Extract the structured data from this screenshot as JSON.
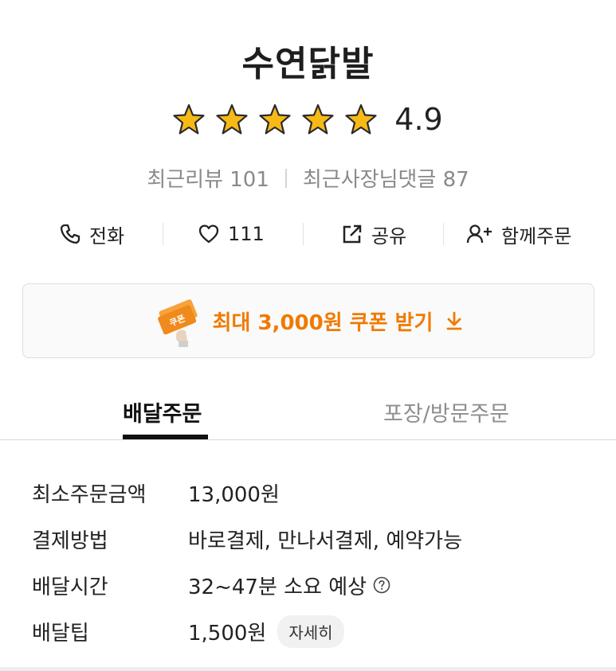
{
  "store": {
    "name": "수연닭발",
    "rating": "4.9",
    "stars": 5,
    "recent_reviews": "최근리뷰 101",
    "recent_owner_replies": "최근사장님댓글 87"
  },
  "actions": {
    "call_label": "전화",
    "like_count": "111",
    "share_label": "공유",
    "group_order_label": "함께주문"
  },
  "coupon": {
    "text": "최대 3,000원 쿠폰 받기",
    "icon_text": "쿠폰",
    "accent_color": "#f07a00"
  },
  "tabs": [
    {
      "label": "배달주문",
      "active": true
    },
    {
      "label": "포장/방문주문",
      "active": false
    }
  ],
  "info": {
    "min_order_label": "최소주문금액",
    "min_order_value": "13,000원",
    "payment_label": "결제방법",
    "payment_value": "바로결제, 만나서결제, 예약가능",
    "delivery_time_label": "배달시간",
    "delivery_time_value": "32~47분 소요 예상",
    "delivery_tip_label": "배달팁",
    "delivery_tip_value": "1,500원",
    "detail_button": "자세히"
  },
  "icons": {
    "star": "star-icon",
    "phone": "phone-icon",
    "heart": "heart-icon",
    "share": "share-icon",
    "group": "add-person-icon",
    "download": "download-arrow-icon",
    "help": "question-circle-icon"
  }
}
